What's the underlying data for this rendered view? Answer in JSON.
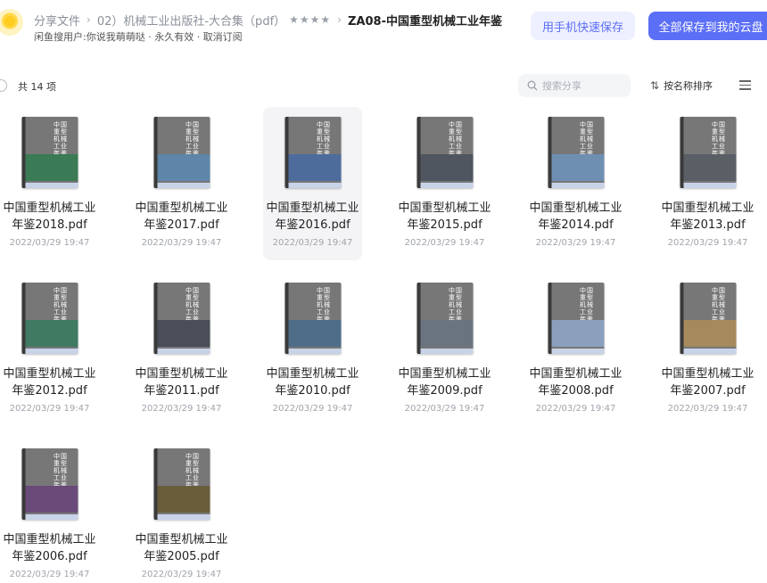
{
  "header": {
    "breadcrumbs": [
      "分享文件",
      "02）机械工业出版社-大合集（pdf）",
      "ZA08-中国重型机械工业年鉴"
    ],
    "rating": "★★★★",
    "subline": "闲鱼搜用户:你说我萌萌哒 · 永久有效 · 取消订阅",
    "btn_phone": "用手机快速保存",
    "btn_save_all": "全部保存到我的云盘"
  },
  "toolbar": {
    "count": "共 14 项",
    "search_placeholder": "搜索分享",
    "sort_label": "按名称排序"
  },
  "files": [
    {
      "line1": "中国重型机械工业",
      "line2": "年鉴2018.pdf",
      "date": "2022/03/29 19:47",
      "band": "#3a7a55"
    },
    {
      "line1": "中国重型机械工业",
      "line2": "年鉴2017.pdf",
      "date": "2022/03/29 19:47",
      "band": "#5d86a8"
    },
    {
      "line1": "中国重型机械工业",
      "line2": "年鉴2016.pdf",
      "date": "2022/03/29 19:47",
      "band": "#4d6c9c"
    },
    {
      "line1": "中国重型机械工业",
      "line2": "年鉴2015.pdf",
      "date": "2022/03/29 19:47",
      "band": "#4f5660"
    },
    {
      "line1": "中国重型机械工业",
      "line2": "年鉴2014.pdf",
      "date": "2022/03/29 19:47",
      "band": "#6e8fb2"
    },
    {
      "line1": "中国重型机械工业",
      "line2": "年鉴2013.pdf",
      "date": "2022/03/29 19:47",
      "band": "#5a5f66"
    },
    {
      "line1": "中国重型机械工业",
      "line2": "年鉴2012.pdf",
      "date": "2022/03/29 19:47",
      "band": "#3f7a62"
    },
    {
      "line1": "中国重型机械工业",
      "line2": "年鉴2011.pdf",
      "date": "2022/03/29 19:47",
      "band": "#4a4e58"
    },
    {
      "line1": "中国重型机械工业",
      "line2": "年鉴2010.pdf",
      "date": "2022/03/29 19:47",
      "band": "#4f6d88"
    },
    {
      "line1": "中国重型机械工业",
      "line2": "年鉴2009.pdf",
      "date": "2022/03/29 19:47",
      "band": "#6a7380"
    },
    {
      "line1": "中国重型机械工业",
      "line2": "年鉴2008.pdf",
      "date": "2022/03/29 19:47",
      "band": "#8aa0bd"
    },
    {
      "line1": "中国重型机械工业",
      "line2": "年鉴2007.pdf",
      "date": "2022/03/29 19:47",
      "band": "#a58a5c"
    },
    {
      "line1": "中国重型机械工业",
      "line2": "年鉴2006.pdf",
      "date": "2022/03/29 19:47",
      "band": "#6a4a78"
    },
    {
      "line1": "中国重型机械工业",
      "line2": "年鉴2005.pdf",
      "date": "2022/03/29 19:47",
      "band": "#6a5e3a"
    }
  ],
  "selected_index": 2,
  "colors": {
    "accent": "#5b6ef6",
    "accent_light": "#eef0ff",
    "selected_bg": "#f4f4f6"
  },
  "icons": {
    "avatar": "sun-avatar-icon",
    "search": "search-icon",
    "sort": "sort-arrows-icon",
    "menu": "list-menu-icon",
    "file_thumb": "pdf-cover-thumbnail"
  }
}
